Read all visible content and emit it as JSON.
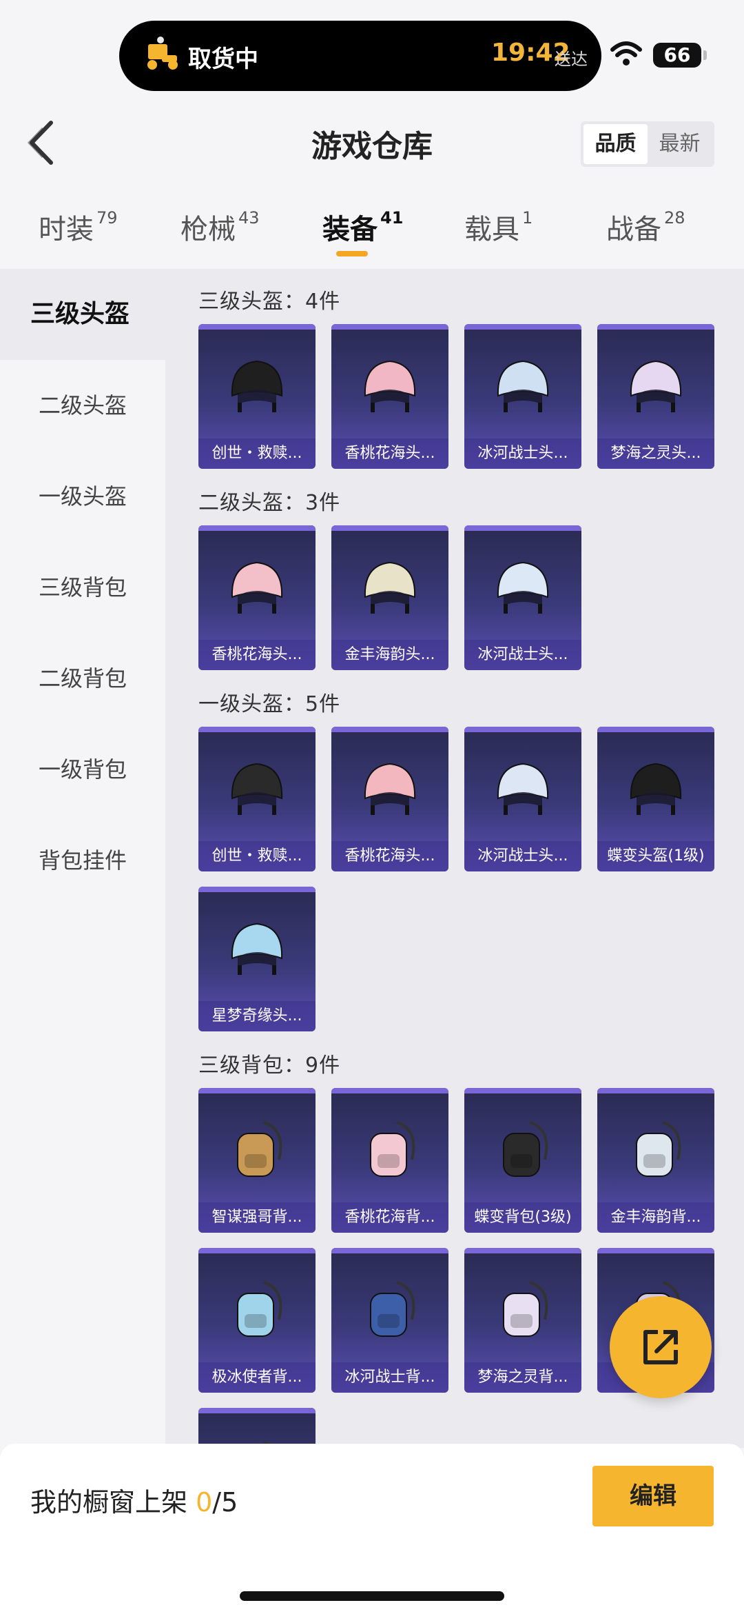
{
  "status": {
    "delivery_label": "取货中",
    "time": "19:42",
    "eta_label": "送达",
    "battery": "66"
  },
  "header": {
    "title": "游戏仓库",
    "sort_quality": "品质",
    "sort_latest": "最新"
  },
  "tabs": [
    {
      "label": "时装",
      "count": "79"
    },
    {
      "label": "枪械",
      "count": "43"
    },
    {
      "label": "装备",
      "count": "41"
    },
    {
      "label": "载具",
      "count": "1"
    },
    {
      "label": "战备",
      "count": "28"
    }
  ],
  "sidebar": {
    "items": [
      {
        "label": "三级头盔"
      },
      {
        "label": "二级头盔"
      },
      {
        "label": "一级头盔"
      },
      {
        "label": "三级背包"
      },
      {
        "label": "二级背包"
      },
      {
        "label": "一级背包"
      },
      {
        "label": "背包挂件"
      }
    ]
  },
  "sections": [
    {
      "title": "三级头盔：4件",
      "items": [
        {
          "name": "创世・救赎...",
          "icon": "helmet-icon",
          "color": "#1f1f1f"
        },
        {
          "name": "香桃花海头...",
          "icon": "helmet-icon",
          "color": "#f1b7c4"
        },
        {
          "name": "冰河战士头...",
          "icon": "helmet-icon",
          "color": "#cfe0f2"
        },
        {
          "name": "梦海之灵头...",
          "icon": "helmet-icon",
          "color": "#e6d8f0"
        }
      ]
    },
    {
      "title": "二级头盔：3件",
      "items": [
        {
          "name": "香桃花海头...",
          "icon": "helmet-icon",
          "color": "#f3bfc9"
        },
        {
          "name": "金丰海韵头...",
          "icon": "helmet-icon",
          "color": "#e8e2c8"
        },
        {
          "name": "冰河战士头...",
          "icon": "helmet-icon",
          "color": "#dce8f6"
        }
      ]
    },
    {
      "title": "一级头盔：5件",
      "items": [
        {
          "name": "创世・救赎...",
          "icon": "helmet-icon",
          "color": "#2a2a2a"
        },
        {
          "name": "香桃花海头...",
          "icon": "helmet-icon",
          "color": "#f3b7bf"
        },
        {
          "name": "冰河战士头...",
          "icon": "helmet-icon",
          "color": "#dce6f4"
        },
        {
          "name": "蝶变头盔(1级)",
          "icon": "helmet-icon",
          "color": "#1e1e1e"
        },
        {
          "name": "星梦奇缘头...",
          "icon": "helmet-icon",
          "color": "#a8d8f0"
        }
      ]
    },
    {
      "title": "三级背包：9件",
      "items": [
        {
          "name": "智谋强哥背...",
          "icon": "backpack-icon",
          "color": "#c99a56"
        },
        {
          "name": "香桃花海背...",
          "icon": "backpack-icon",
          "color": "#f4c8d2"
        },
        {
          "name": "蝶变背包(3级)",
          "icon": "backpack-icon",
          "color": "#2a2a2a"
        },
        {
          "name": "金丰海韵背...",
          "icon": "backpack-icon",
          "color": "#dfe7ee"
        },
        {
          "name": "极冰使者背...",
          "icon": "backpack-icon",
          "color": "#9fd4ea"
        },
        {
          "name": "冰河战士背...",
          "icon": "backpack-icon",
          "color": "#3d5ea8"
        },
        {
          "name": "梦海之灵背...",
          "icon": "backpack-icon",
          "color": "#e8e0f2"
        },
        {
          "name": "金...",
          "icon": "backpack-icon",
          "color": "#d8cde8"
        },
        {
          "name": "",
          "icon": "backpack-icon",
          "color": "#3a3a3a"
        }
      ]
    }
  ],
  "bottom": {
    "shelf_label": "我的橱窗上架 ",
    "shelf_current": "0",
    "shelf_total": "/5",
    "edit_label": "编辑"
  }
}
